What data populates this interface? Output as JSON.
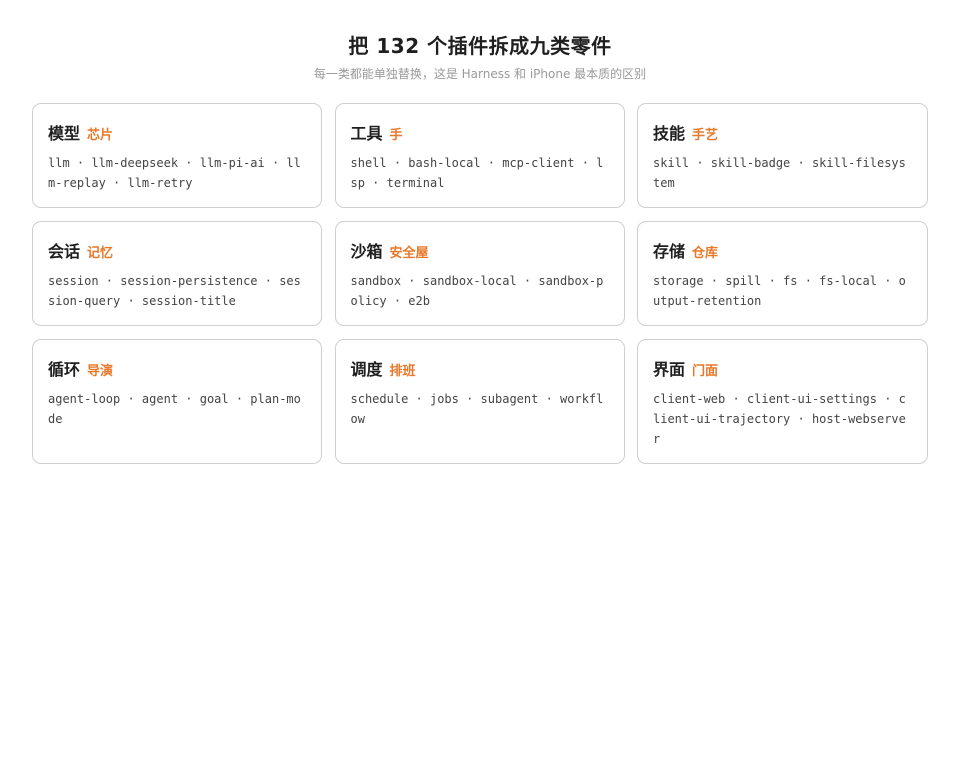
{
  "header": {
    "title": "把 132 个插件拆成九类零件",
    "subtitle": "每一类都能单独替换，这是 Harness 和 iPhone 最本质的区别"
  },
  "cards": [
    {
      "name": "模型",
      "tag": "芯片",
      "items": "llm · llm-deepseek · llm-pi-ai · llm-replay · llm-retry"
    },
    {
      "name": "工具",
      "tag": "手",
      "items": "shell · bash-local · mcp-client · lsp · terminal"
    },
    {
      "name": "技能",
      "tag": "手艺",
      "items": "skill · skill-badge · skill-filesystem"
    },
    {
      "name": "会话",
      "tag": "记忆",
      "items": "session · session-persistence · session-query · session-title"
    },
    {
      "name": "沙箱",
      "tag": "安全屋",
      "items": "sandbox · sandbox-local · sandbox-policy · e2b"
    },
    {
      "name": "存储",
      "tag": "仓库",
      "items": "storage · spill · fs · fs-local · output-retention"
    },
    {
      "name": "循环",
      "tag": "导演",
      "items": "agent-loop · agent · goal · plan-mode"
    },
    {
      "name": "调度",
      "tag": "排班",
      "items": "schedule · jobs · subagent · workflow"
    },
    {
      "name": "界面",
      "tag": "门面",
      "items": "client-web · client-ui-settings · client-ui-trajectory · host-webserver"
    }
  ],
  "colors": {
    "accent": "#e8782a",
    "border": "#cfcfcf",
    "subtitle": "#9a9a9a"
  }
}
